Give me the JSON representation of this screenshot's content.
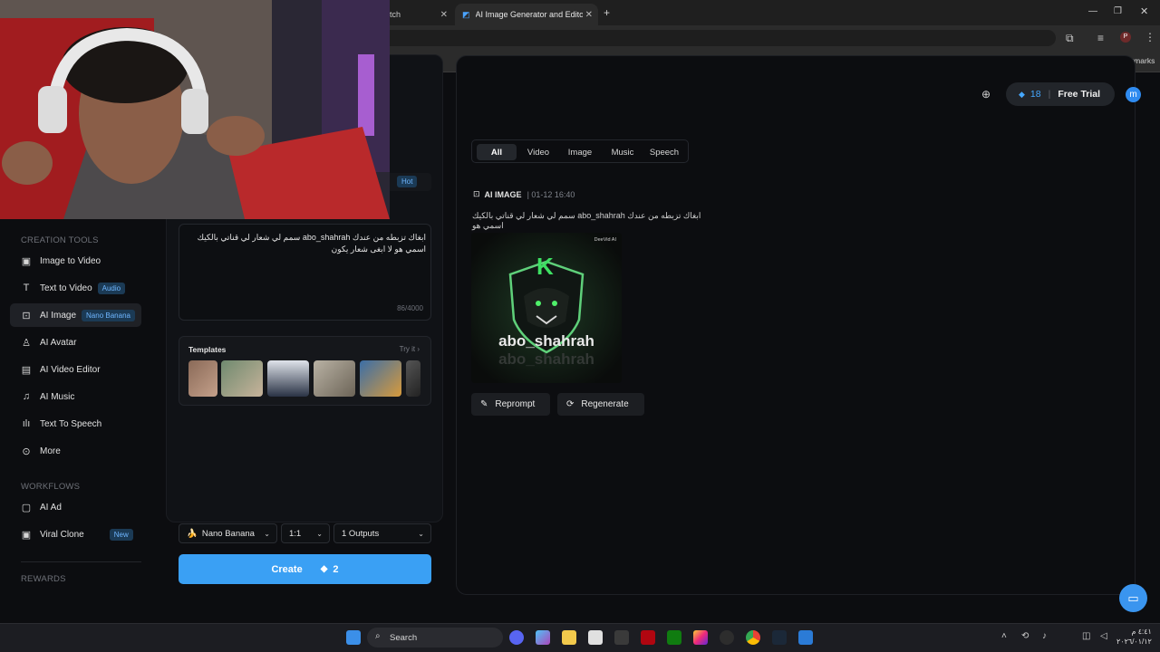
{
  "browser": {
    "tabs": [
      {
        "label": "itch"
      },
      {
        "label": "AI Image Generator and Editor"
      }
    ],
    "bookmarks_label": "All Bookmarks"
  },
  "header": {
    "credits": "18",
    "free_trial_label": "Free Trial",
    "avatar_initial": "m"
  },
  "sidebar": {
    "creation_tools_label": "CREATION TOOLS",
    "items": [
      {
        "label": "Image to Video",
        "badge": ""
      },
      {
        "label": "Text to Video",
        "badge": "Audio"
      },
      {
        "label": "AI Image",
        "badge": "Nano Banana"
      },
      {
        "label": "AI Avatar",
        "badge": ""
      },
      {
        "label": "AI Video Editor",
        "badge": ""
      },
      {
        "label": "AI Music",
        "badge": ""
      },
      {
        "label": "Text To Speech",
        "badge": ""
      },
      {
        "label": "More",
        "badge": ""
      }
    ],
    "workflows_label": "WORKFLOWS",
    "workflows": [
      {
        "label": "AI Ad",
        "badge": ""
      },
      {
        "label": "Viral Clone",
        "badge": "New"
      }
    ],
    "rewards_label": "REWARDS"
  },
  "left_panel": {
    "hot_badge": "Hot",
    "prompt_text": "ابغاك تزبطه من عندك abo_shahrah سمم لي شعار لي قناتي بالكيك اسمي هو لا ابغى شعار يكون",
    "char_count": "86/4000",
    "templates_title": "Templates",
    "templates_try": "Try it",
    "model_select": "Nano Banana",
    "ratio_select": "1:1",
    "outputs_select": "1 Outputs",
    "create_label": "Create",
    "create_cost": "2"
  },
  "right_panel": {
    "filter_tabs": [
      "All",
      "Video",
      "Image",
      "Music",
      "Speech"
    ],
    "active_tab": "All",
    "result_type": "AI IMAGE",
    "result_time": "| 01-12 16:40",
    "result_prompt": "ابغاك تزبطه من عندك abo_shahrah سمم لي شعار لي قناتي بالكيك اسمي هو",
    "image_logo_letter": "K",
    "image_logo_text": "abo_shahrah",
    "image_watermark": "DeeVid AI",
    "reprompt_label": "Reprompt",
    "regenerate_label": "Regenerate"
  },
  "taskbar": {
    "search_label": "Search",
    "clock_time": "٤:٤١ م",
    "clock_date": "٢٠٢٦/٠١/١٢"
  },
  "colors": {
    "accent_blue": "#3aa0f4",
    "bg": "#0b0c0f"
  }
}
